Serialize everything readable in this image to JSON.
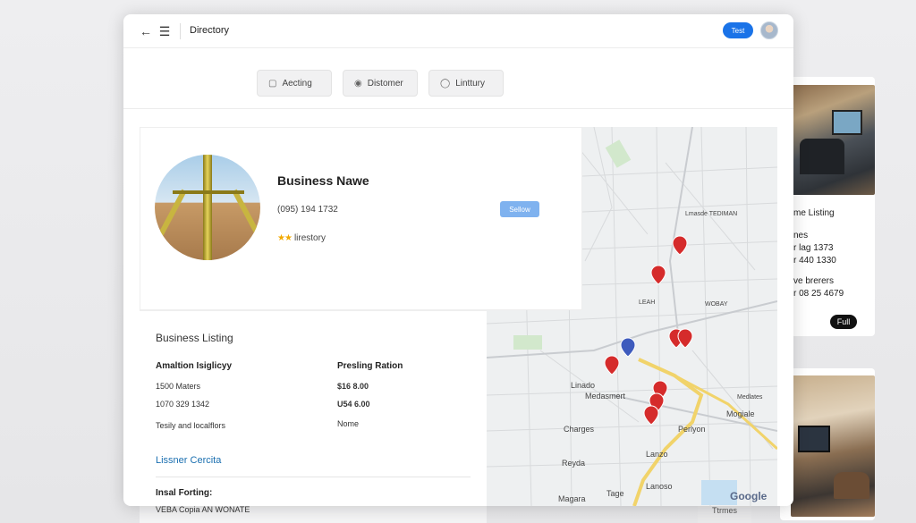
{
  "header": {
    "title": "Directory",
    "primary_button": "Test"
  },
  "filters": [
    {
      "label": "Aecting",
      "icon": "user-tag-icon"
    },
    {
      "label": "Distomer",
      "icon": "camera-icon"
    },
    {
      "label": "Linttury",
      "icon": "person-icon"
    }
  ],
  "business": {
    "name": "Business Nawe",
    "phone": "(095) 194 1732",
    "rating_stars": "★★",
    "rating_label": "lirestory",
    "follow_label": "Sellow"
  },
  "details": {
    "title": "Business Listing",
    "left_header": "Amaltion Isiglicyy",
    "right_header": "Presling Ration",
    "left_rows": [
      "1500 Maters",
      "1070 329 1342",
      "Tesily and localflors"
    ],
    "right_rows": [
      "$16 8.00",
      "U54 6.00",
      "Nome"
    ],
    "link": "Lissner Cercita",
    "footer_label": "Insal Forting:",
    "footer_value": "VEBA Copia AN WONATE"
  },
  "map": {
    "labels": [
      "Lmasde TEDIMAN",
      "LEAH",
      "WOBAY",
      "Linado",
      "Medasmert",
      "Charges",
      "Perlyon",
      "Mogiale",
      "Medlates",
      "Reyda",
      "Lanzo",
      "Lanoso",
      "Magara",
      "Tage"
    ],
    "attribution": "Google"
  },
  "side_panel": {
    "title": "me Listing",
    "line1": "nes",
    "line2": "r lag 1373",
    "line3": "r 440 1330",
    "line4": "ve brerers",
    "line5": "r 08 25 4679",
    "button": "Full"
  },
  "bottom_right_text": "Ttrmes"
}
